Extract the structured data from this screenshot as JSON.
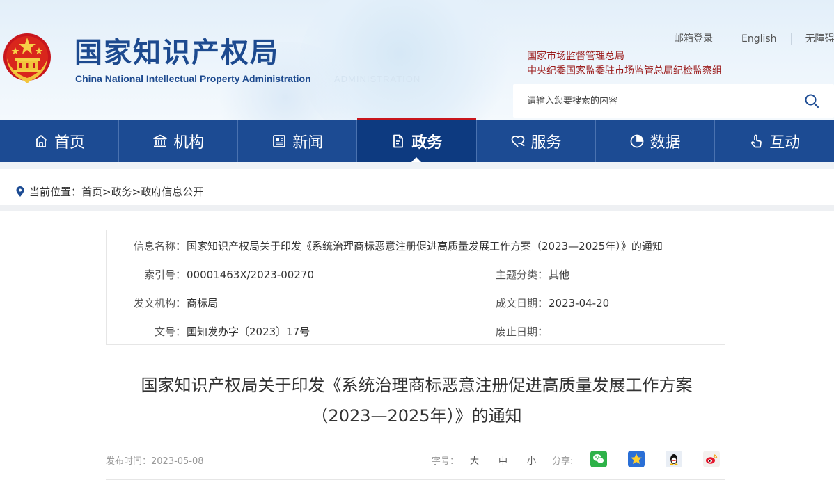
{
  "header": {
    "logo_cn": "国家知识产权局",
    "logo_en": "China National Intellectual Property Administration",
    "bg_text": "ADMINISTRATION",
    "top_links": [
      "邮箱登录",
      "English",
      "无障碍"
    ],
    "related_orgs": [
      "国家市场监督管理总局",
      "中央纪委国家监委驻市场监管总局纪检监察组"
    ],
    "search_placeholder": "请输入您要搜索的内容"
  },
  "nav": {
    "items": [
      {
        "label": "首页",
        "icon": "home-icon"
      },
      {
        "label": "机构",
        "icon": "building-icon"
      },
      {
        "label": "新闻",
        "icon": "news-icon"
      },
      {
        "label": "政务",
        "icon": "document-icon",
        "active": true
      },
      {
        "label": "服务",
        "icon": "heart-hand-icon"
      },
      {
        "label": "数据",
        "icon": "pie-chart-icon"
      },
      {
        "label": "互动",
        "icon": "pointer-hand-icon"
      }
    ]
  },
  "breadcrumb": {
    "prefix": "当前位置：",
    "items": [
      "首页",
      "政务",
      "政府信息公开"
    ],
    "separator": ">"
  },
  "info": {
    "name_label": "信息名称：",
    "name_value": "国家知识产权局关于印发《系统治理商标恶意注册促进高质量发展工作方案（2023—2025年）》的通知",
    "index_label": "索引号：",
    "index_value": "00001463X/2023-00270",
    "topic_label": "主题分类：",
    "topic_value": "其他",
    "org_label": "发文机构：",
    "org_value": "商标局",
    "date_label": "成文日期：",
    "date_value": "2023-04-20",
    "docno_label": "文号：",
    "docno_value": "国知发办字〔2023〕17号",
    "expire_label": "废止日期：",
    "expire_value": ""
  },
  "article": {
    "title_line1": "国家知识产权局关于印发《系统治理商标恶意注册促进高质量发展工作方案",
    "title_line2": "（2023—2025年）》的通知",
    "publish_label": "发布时间：",
    "publish_date": "2023-05-08",
    "fontsize_label": "字号：",
    "fontsizes": [
      "大",
      "中",
      "小"
    ],
    "share_label": "分享:"
  },
  "colors": {
    "nav_bg": "#1c4b93",
    "nav_active_bg": "#0d3a80",
    "accent_red": "#c8161d",
    "logo_blue": "#1d4a8f",
    "related_red": "#9b1c1c"
  }
}
